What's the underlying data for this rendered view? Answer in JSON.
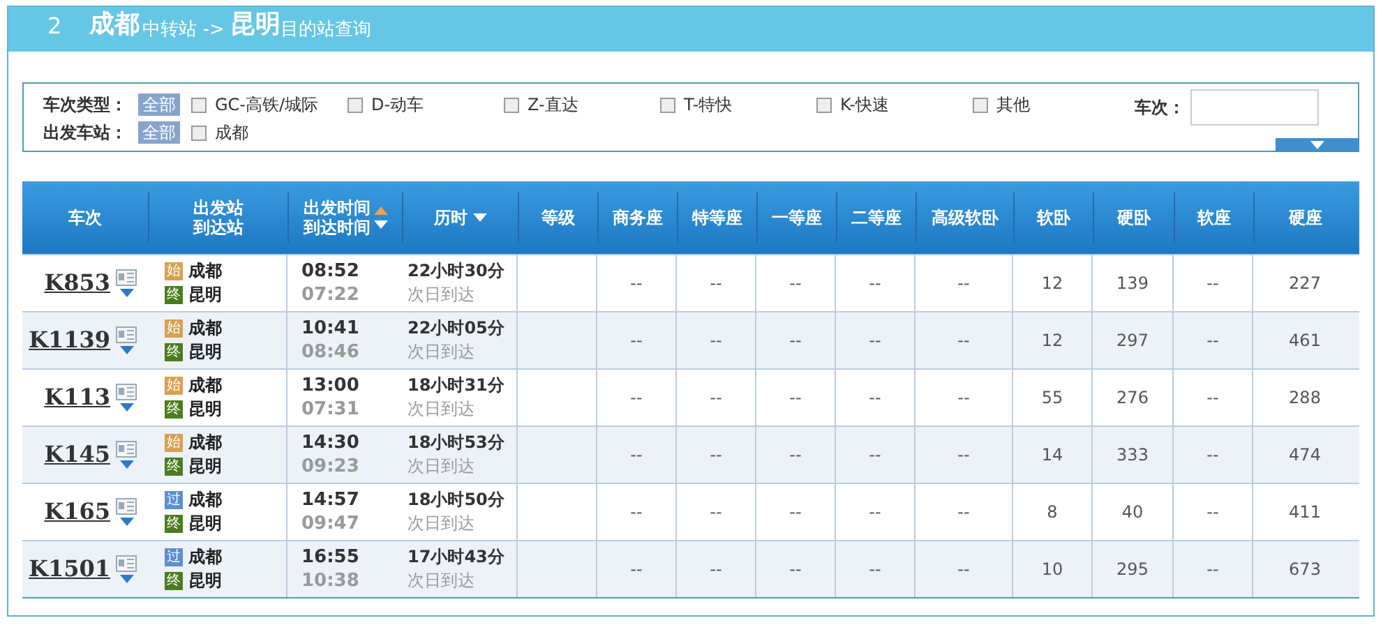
{
  "title": {
    "index": "2",
    "from": "成都",
    "from_suffix": "中转站 ->",
    "to": "昆明",
    "to_suffix": "目的站查询"
  },
  "filters": [
    {
      "label": "车次类型：",
      "all": {
        "label": "全部",
        "selected": true
      },
      "options": [
        {
          "label": "GC-高铁/城际",
          "checked": false
        },
        {
          "label": "D-动车",
          "checked": false
        },
        {
          "label": "Z-直达",
          "checked": false
        },
        {
          "label": "T-特快",
          "checked": false
        },
        {
          "label": "K-快速",
          "checked": false
        },
        {
          "label": "其他",
          "checked": false
        }
      ]
    },
    {
      "label": "出发车站：",
      "all": {
        "label": "全部",
        "selected": true
      },
      "options": [
        {
          "label": "成都",
          "checked": false
        }
      ]
    }
  ],
  "train_search": {
    "label": "车次："
  },
  "columns": [
    {
      "label": "车次"
    },
    {
      "label": "出发站",
      "label2": "到达站"
    },
    {
      "label": "出发时间",
      "label2": "到达时间",
      "sort_up": true,
      "sort_down": true
    },
    {
      "label": "历时",
      "sort_down": true
    },
    {
      "label": "等级"
    },
    {
      "label": "商务座"
    },
    {
      "label": "特等座"
    },
    {
      "label": "一等座"
    },
    {
      "label": "二等座"
    },
    {
      "label": "高级软卧"
    },
    {
      "label": "软卧"
    },
    {
      "label": "硬卧"
    },
    {
      "label": "软座"
    },
    {
      "label": "硬座"
    }
  ],
  "rows": [
    {
      "train": "K853",
      "from": {
        "badge": "始",
        "name": "成都",
        "color": "#d9a050"
      },
      "to": {
        "badge": "终",
        "name": "昆明",
        "color": "#4a7d1e"
      },
      "depart": "08:52",
      "arrive": "07:22",
      "duration": "22小时30分",
      "note": "次日到达",
      "seats": [
        "--",
        "--",
        "--",
        "--",
        "--",
        "12",
        "139",
        "--",
        "227"
      ]
    },
    {
      "train": "K1139",
      "from": {
        "badge": "始",
        "name": "成都",
        "color": "#d9a050"
      },
      "to": {
        "badge": "终",
        "name": "昆明",
        "color": "#4a7d1e"
      },
      "depart": "10:41",
      "arrive": "08:46",
      "duration": "22小时05分",
      "note": "次日到达",
      "seats": [
        "--",
        "--",
        "--",
        "--",
        "--",
        "12",
        "297",
        "--",
        "461"
      ]
    },
    {
      "train": "K113",
      "from": {
        "badge": "始",
        "name": "成都",
        "color": "#d9a050"
      },
      "to": {
        "badge": "终",
        "name": "昆明",
        "color": "#4a7d1e"
      },
      "depart": "13:00",
      "arrive": "07:31",
      "duration": "18小时31分",
      "note": "次日到达",
      "seats": [
        "--",
        "--",
        "--",
        "--",
        "--",
        "55",
        "276",
        "--",
        "288"
      ]
    },
    {
      "train": "K145",
      "from": {
        "badge": "始",
        "name": "成都",
        "color": "#d9a050"
      },
      "to": {
        "badge": "终",
        "name": "昆明",
        "color": "#4a7d1e"
      },
      "depart": "14:30",
      "arrive": "09:23",
      "duration": "18小时53分",
      "note": "次日到达",
      "seats": [
        "--",
        "--",
        "--",
        "--",
        "--",
        "14",
        "333",
        "--",
        "474"
      ]
    },
    {
      "train": "K165",
      "from": {
        "badge": "过",
        "name": "成都",
        "color": "#5b8fd0"
      },
      "to": {
        "badge": "终",
        "name": "昆明",
        "color": "#4a7d1e"
      },
      "depart": "14:57",
      "arrive": "09:47",
      "duration": "18小时50分",
      "note": "次日到达",
      "seats": [
        "--",
        "--",
        "--",
        "--",
        "--",
        "8",
        "40",
        "--",
        "411"
      ]
    },
    {
      "train": "K1501",
      "from": {
        "badge": "过",
        "name": "成都",
        "color": "#5b8fd0"
      },
      "to": {
        "badge": "终",
        "name": "昆明",
        "color": "#4a7d1e"
      },
      "depart": "16:55",
      "arrive": "10:38",
      "duration": "17小时43分",
      "note": "次日到达",
      "seats": [
        "--",
        "--",
        "--",
        "--",
        "--",
        "10",
        "295",
        "--",
        "673"
      ]
    }
  ]
}
